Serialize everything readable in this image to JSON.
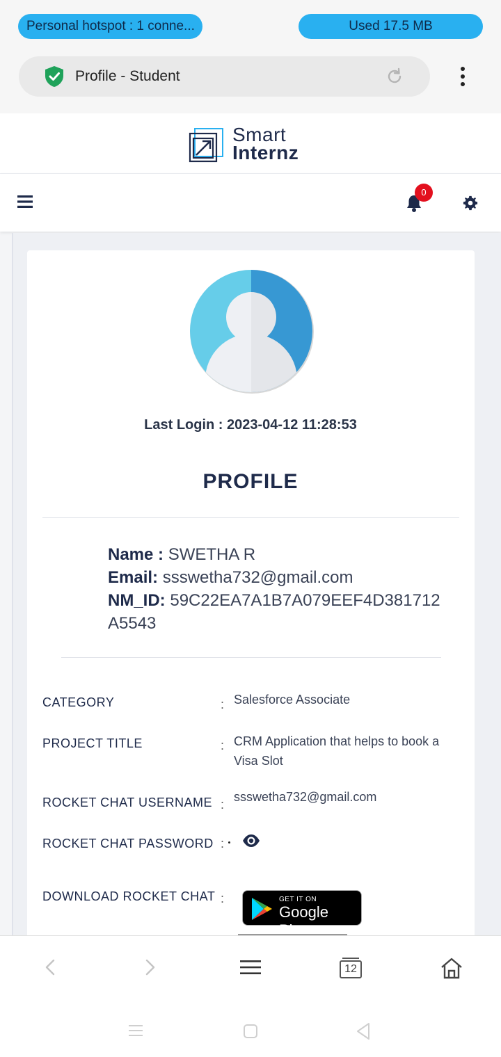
{
  "status": {
    "hotspot": "Personal hotspot : 1 conne...",
    "data_used": "Used  17.5 MB"
  },
  "browser": {
    "url_title": "Profile - Student",
    "tabs_count": "12"
  },
  "site": {
    "logo_line1": "Smart",
    "logo_line2": "Internz",
    "notification_count": "0"
  },
  "profile": {
    "last_login": "Last Login : 2023-04-12 11:28:53",
    "heading": "PROFILE",
    "name_label": "Name :",
    "name_value": "SWETHA R",
    "email_label": "Email:",
    "email_value": "ssswetha732@gmail.com",
    "nmid_label": "NM_ID:",
    "nmid_value": "59C22EA7A1B7A079EEF4D381712A5543"
  },
  "details": {
    "category_label": "CATEGORY",
    "category_value": "Salesforce Associate",
    "project_label": "PROJECT TITLE",
    "project_value": "CRM Application that helps to book a Visa Slot",
    "rc_user_label": "ROCKET CHAT USERNAME",
    "rc_user_value": "ssswetha732@gmail.com",
    "rc_pass_label": "ROCKET CHAT PASSWORD",
    "download_label": "DOWNLOAD ROCKET CHAT",
    "colon": ":"
  },
  "google_play": {
    "small": "GET IT ON",
    "big": "Google Play"
  },
  "colors": {
    "accent": "#29b0f0",
    "brand_navy": "#1e2a4a",
    "badge_red": "#e3101e"
  }
}
